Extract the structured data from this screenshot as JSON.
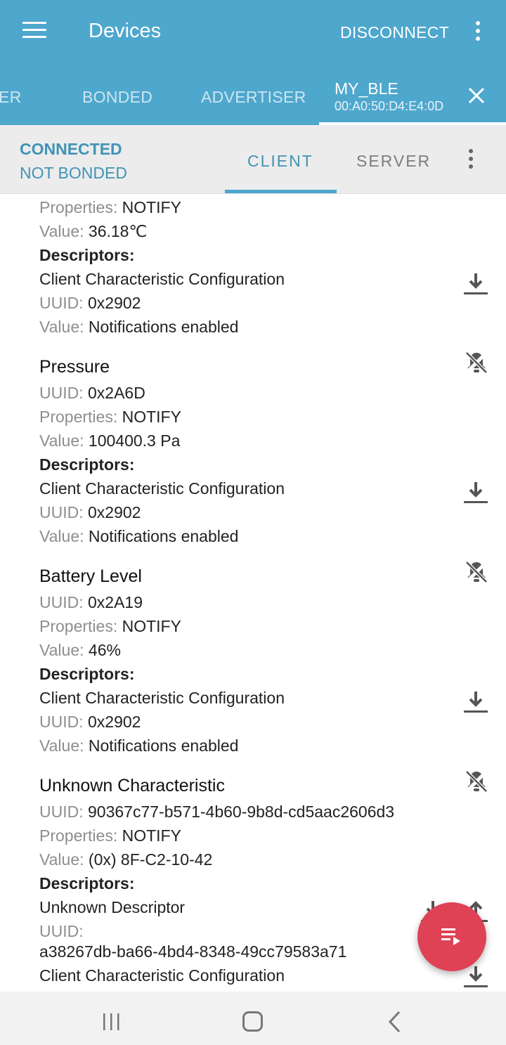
{
  "appbar": {
    "title": "Devices",
    "disconnect_label": "DISCONNECT"
  },
  "tabs": {
    "items": [
      {
        "label": "ER"
      },
      {
        "label": "BONDED"
      },
      {
        "label": "ADVERTISER"
      }
    ],
    "active": {
      "title": "MY_BLE",
      "address": "00:A0:50:D4:E4:0D"
    }
  },
  "status": {
    "connection": "CONNECTED",
    "bond": "NOT BONDED"
  },
  "subtabs": {
    "client": "CLIENT",
    "server": "SERVER"
  },
  "labels": {
    "uuid": "UUID: ",
    "properties": "Properties: ",
    "value": "Value: ",
    "descriptors": "Descriptors:"
  },
  "characteristics": [
    {
      "name": "",
      "properties": "NOTIFY",
      "value": "36.18℃",
      "descriptor": {
        "name": "Client Characteristic Configuration",
        "uuid": "0x2902",
        "value": "Notifications enabled"
      }
    },
    {
      "name": "Pressure",
      "uuid": "0x2A6D",
      "properties": "NOTIFY",
      "value": "100400.3 Pa",
      "descriptor": {
        "name": "Client Characteristic Configuration",
        "uuid": "0x2902",
        "value": "Notifications enabled"
      }
    },
    {
      "name": "Battery Level",
      "uuid": "0x2A19",
      "properties": "NOTIFY",
      "value": "46%",
      "descriptor": {
        "name": "Client Characteristic Configuration",
        "uuid": "0x2902",
        "value": "Notifications enabled"
      }
    },
    {
      "name": "Unknown Characteristic",
      "uuid": "90367c77-b571-4b60-9b8d-cd5aac2606d3",
      "properties": "NOTIFY",
      "value": "(0x) 8F-C2-10-42",
      "descriptors": [
        {
          "name": "Unknown Descriptor",
          "uuid_label": "UUID:",
          "uuid": "a38267db-ba66-4bd4-8348-49cc79583a71"
        },
        {
          "name": "Client Characteristic Configuration"
        }
      ]
    }
  ],
  "icons": {
    "menu": "menu-icon",
    "overflow": "more-vert-icon",
    "close": "close-icon",
    "download": "download-icon",
    "upload": "upload-icon",
    "notifications_off": "notifications-disabled-icon",
    "fab": "log-list-icon"
  },
  "colors": {
    "appbar": "#4ea7cd",
    "accent": "#4193b6",
    "fab": "#de4254"
  }
}
